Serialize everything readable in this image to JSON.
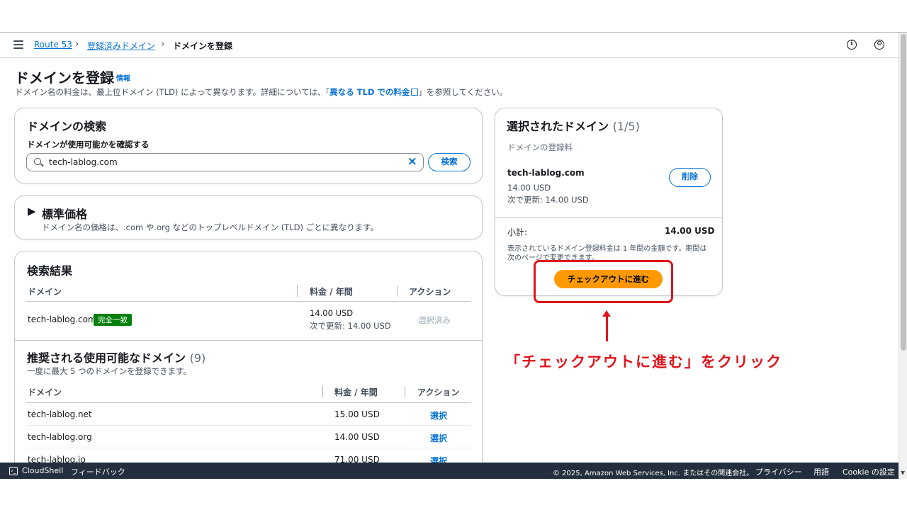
{
  "breadcrumb": {
    "items": [
      "Route 53",
      "登録済みドメイン",
      "ドメインを登録"
    ]
  },
  "page": {
    "title": "ドメインを登録",
    "info": "情報",
    "desc_before": "ドメイン名の料金は、最上位ドメイン (TLD) によって異なります。詳細については、「",
    "desc_link": "異なる TLD での料金",
    "desc_after": "」を参照してください。"
  },
  "search": {
    "title": "ドメインの検索",
    "label": "ドメインが使用可能かを確認する",
    "value": "tech-lablog.com",
    "button": "検索"
  },
  "standard_pricing": {
    "title": "標準価格",
    "desc": "ドメイン名の価格は、.com や.org などのトップレベルドメイン (TLD) ごとに異なります。"
  },
  "results": {
    "title": "検索結果",
    "headers": [
      "ドメイン",
      "料金 / 年間",
      "アクション"
    ],
    "row": {
      "domain": "tech-lablog.com",
      "badge": "完全一致",
      "price": "14.00 USD",
      "renewal": "次で更新: 14.00 USD",
      "action": "選択済み"
    }
  },
  "suggested": {
    "title": "推奨される使用可能なドメイン",
    "count": "(9)",
    "desc": "一度に最大 5 つのドメインを登録できます。",
    "headers": [
      "ドメイン",
      "料金 / 年間",
      "アクション"
    ],
    "rows": [
      {
        "domain": "tech-lablog.net",
        "price": "15.00 USD",
        "action": "選択"
      },
      {
        "domain": "tech-lablog.org",
        "price": "14.00 USD",
        "action": "選択"
      },
      {
        "domain": "tech-lablog.io",
        "price": "71.00 USD",
        "action": "選択"
      }
    ]
  },
  "selected": {
    "title": "選択されたドメイン",
    "count": "(1/5)",
    "subtitle": "ドメインの登録料",
    "domain": "tech-lablog.com",
    "price": "14.00 USD",
    "renewal": "次で更新: 14.00 USD",
    "remove": "削除",
    "subtotal_label": "小計:",
    "subtotal_value": "14.00 USD",
    "note_line1": "表示されているドメイン登録料金は 1 年間の金額です。期間は",
    "note_line2": "次のページで変更できます。",
    "checkout": "チェックアウトに進む"
  },
  "annotation": "「チェックアウトに進む」をクリック",
  "footer": {
    "cloudshell": "CloudShell",
    "feedback": "フィードバック",
    "copyright": "© 2025, Amazon Web Services, Inc. またはその関連会社。",
    "privacy": "プライバシー",
    "terms": "用語",
    "cookie": "Cookie の設定"
  },
  "colors": {
    "link": "#0972d3",
    "primary_button": "#ff9900",
    "annotation": "#e0141c",
    "badge": "#037f0c",
    "footer": "#232f3e"
  }
}
